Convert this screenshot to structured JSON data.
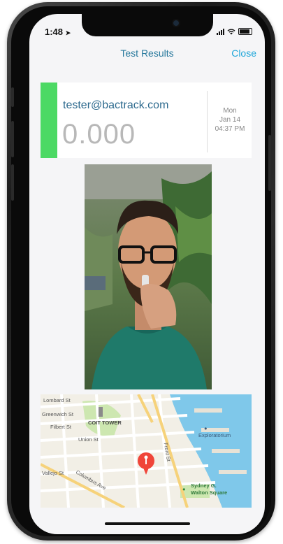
{
  "status_bar": {
    "time": "1:48"
  },
  "nav": {
    "title": "Test Results",
    "close_label": "Close"
  },
  "result": {
    "email": "tester@bactrack.com",
    "bac": "0.000",
    "day": "Mon",
    "date": "Jan 14",
    "time": "04:37 PM",
    "status_color": "#4cd964"
  },
  "map": {
    "streets": {
      "lombard": "Lombard St",
      "greenwich": "Greenwich St",
      "filbert": "Filbert St",
      "union": "Union St",
      "vallejo": "Vallejo St",
      "columbus": "Columbus Ave",
      "front": "Front St"
    },
    "landmarks": {
      "coit_tower": "COIT TOWER",
      "exploratorium": "Exploratorium",
      "sydney_line1": "Sydney G.",
      "sydney_line2": "Walton Square"
    }
  }
}
